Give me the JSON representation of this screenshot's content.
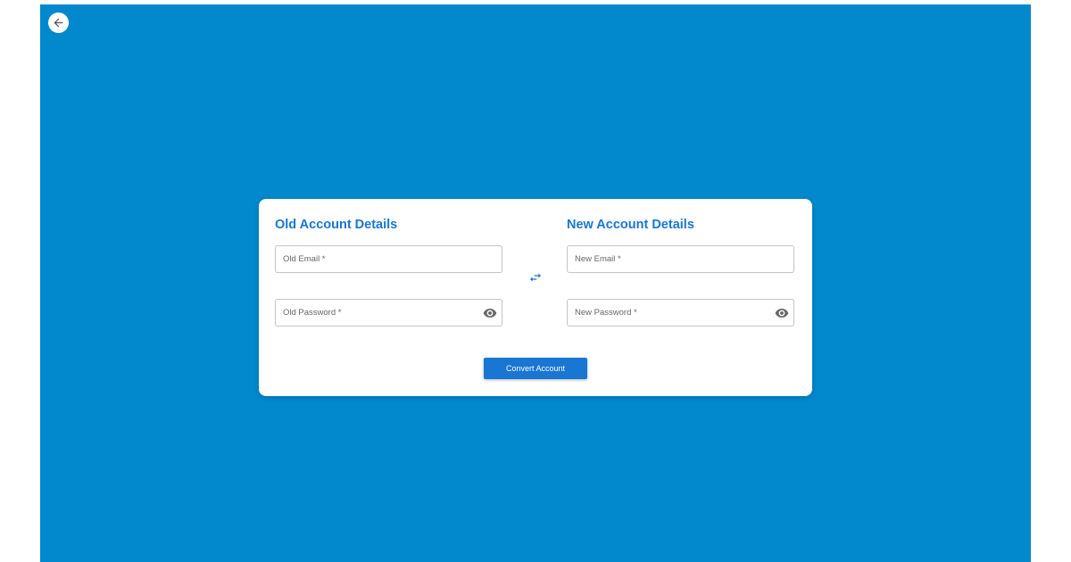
{
  "back_button": {
    "icon": "arrow-left-icon"
  },
  "form": {
    "old_section": {
      "title": "Old Account Details",
      "email_placeholder": "Old Email *",
      "email_value": "",
      "password_placeholder": "Old Password *",
      "password_value": "",
      "password_toggle_icon": "eye-icon"
    },
    "swap_icon": "swap-horiz-icon",
    "new_section": {
      "title": "New Account Details",
      "email_placeholder": "New Email *",
      "email_value": "",
      "password_placeholder": "New Password *",
      "password_value": "",
      "password_toggle_icon": "eye-icon"
    },
    "submit_label": "Convert Account"
  },
  "colors": {
    "background": "#0288cc",
    "accent": "#1976d2",
    "card": "#ffffff"
  }
}
